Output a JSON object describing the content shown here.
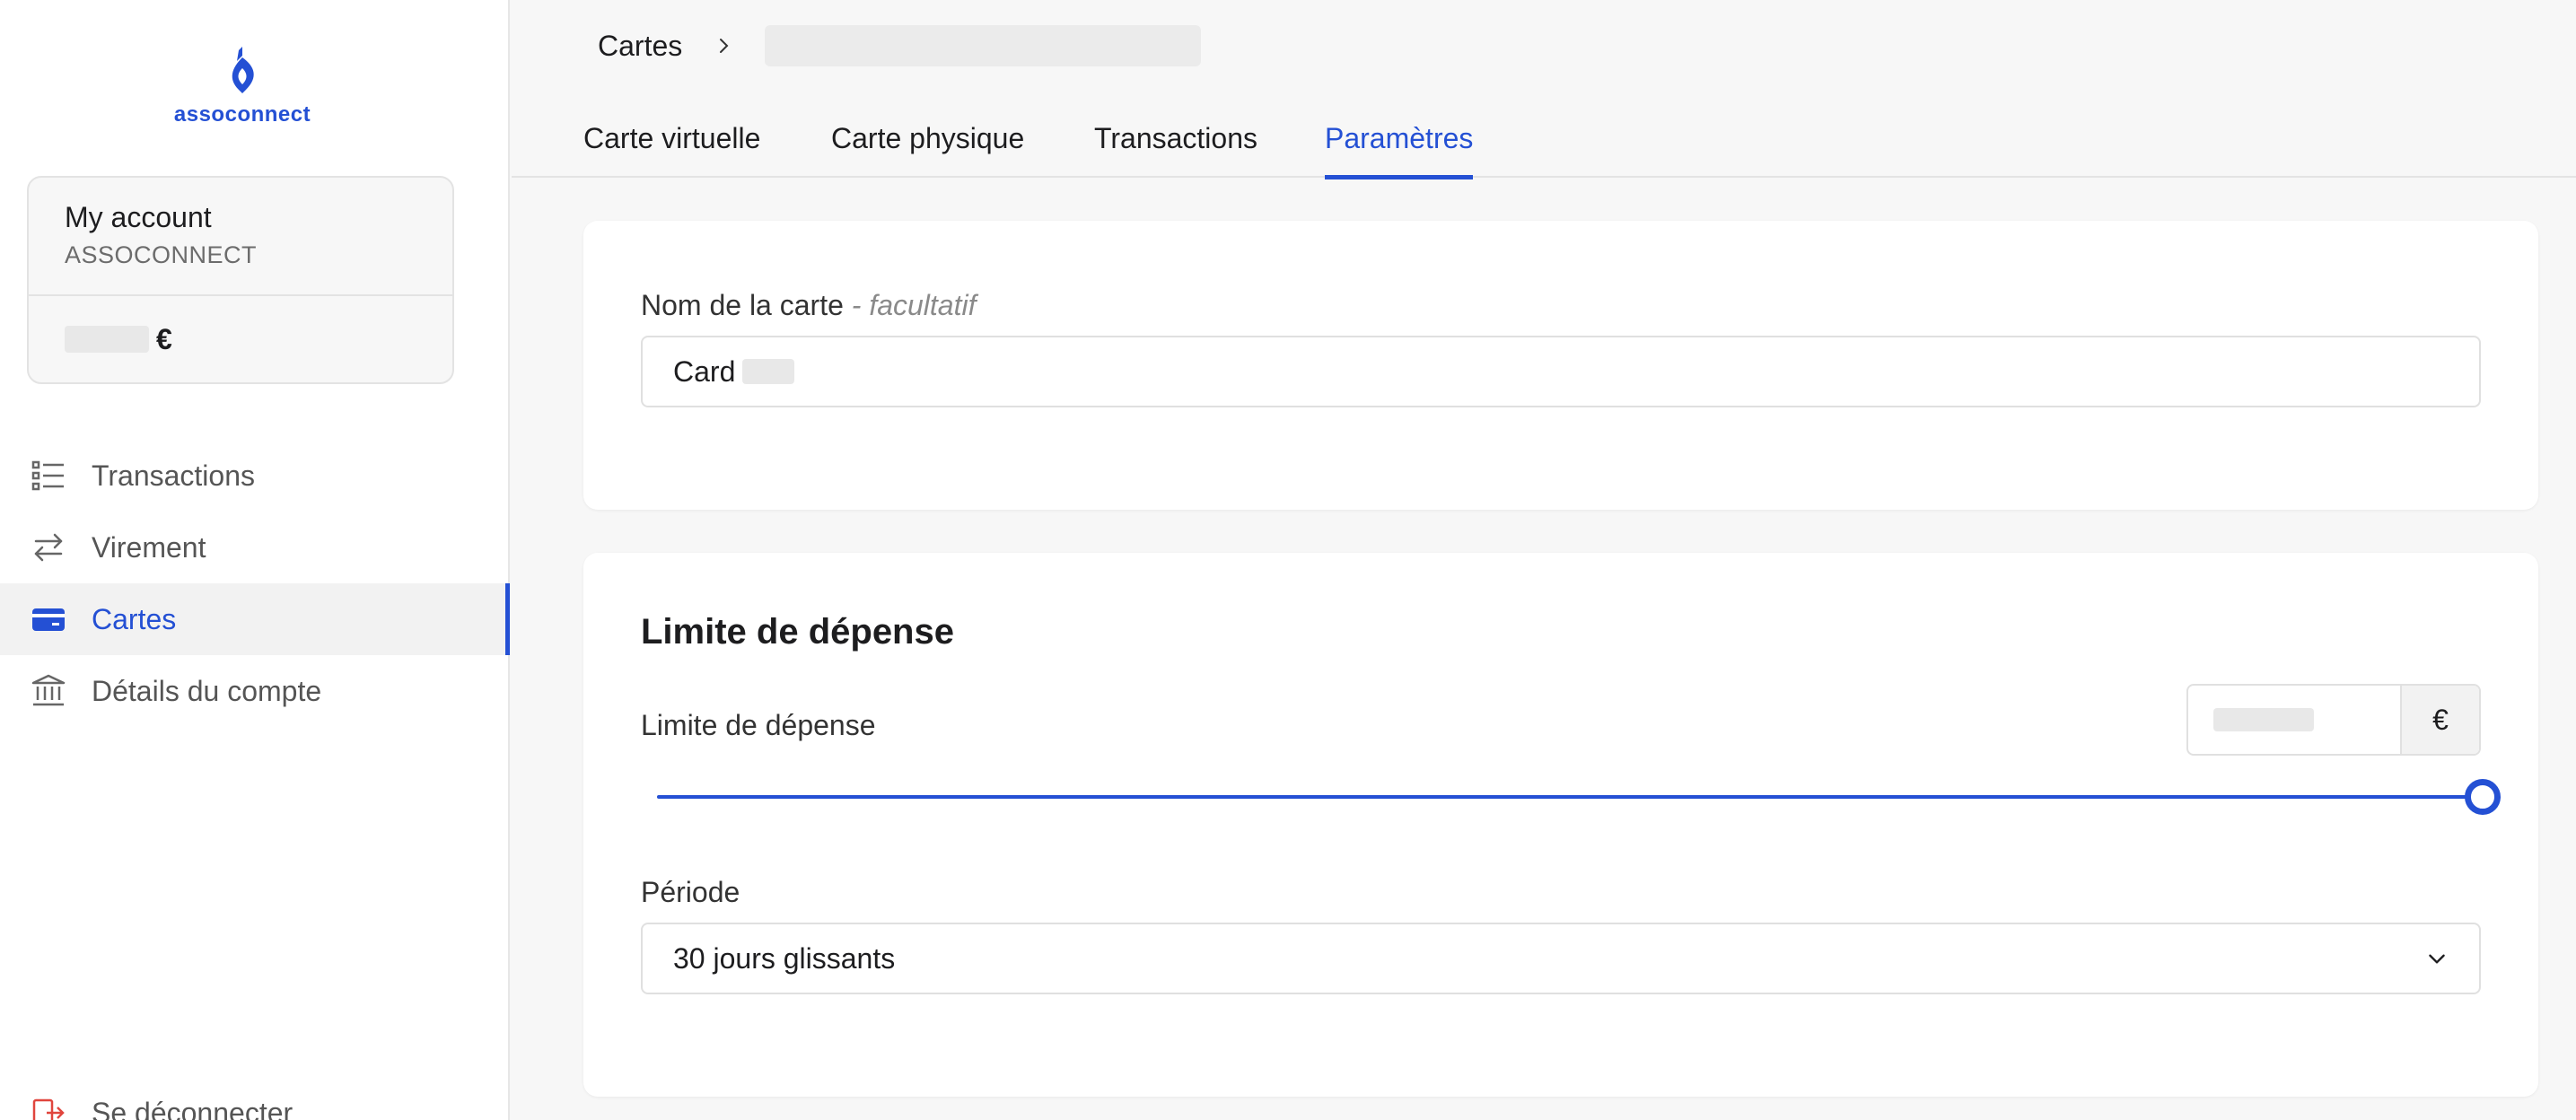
{
  "brand": {
    "name": "assoconnect",
    "accent": "#2450d4"
  },
  "account": {
    "title": "My account",
    "organization": "ASSOCONNECT",
    "currency": "€"
  },
  "nav": {
    "items": [
      {
        "label": "Transactions",
        "icon": "list-icon",
        "active": false
      },
      {
        "label": "Virement",
        "icon": "transfer-arrows-icon",
        "active": false
      },
      {
        "label": "Cartes",
        "icon": "credit-card-icon",
        "active": true
      },
      {
        "label": "Détails du compte",
        "icon": "bank-icon",
        "active": false
      }
    ],
    "logout_label": "Se déconnecter"
  },
  "breadcrumb": {
    "root": "Cartes"
  },
  "tabs": [
    {
      "label": "Carte virtuelle",
      "active": false
    },
    {
      "label": "Carte physique",
      "active": false
    },
    {
      "label": "Transactions",
      "active": false
    },
    {
      "label": "Paramètres",
      "active": true
    }
  ],
  "card_name_section": {
    "label": "Nom de la carte",
    "optional": " - facultatif",
    "value": "Card"
  },
  "limit_section": {
    "title": "Limite de dépense",
    "label": "Limite de dépense",
    "currency": "€",
    "slider_fraction": 1.0,
    "period_label": "Période",
    "period_value": "30 jours glissants"
  }
}
